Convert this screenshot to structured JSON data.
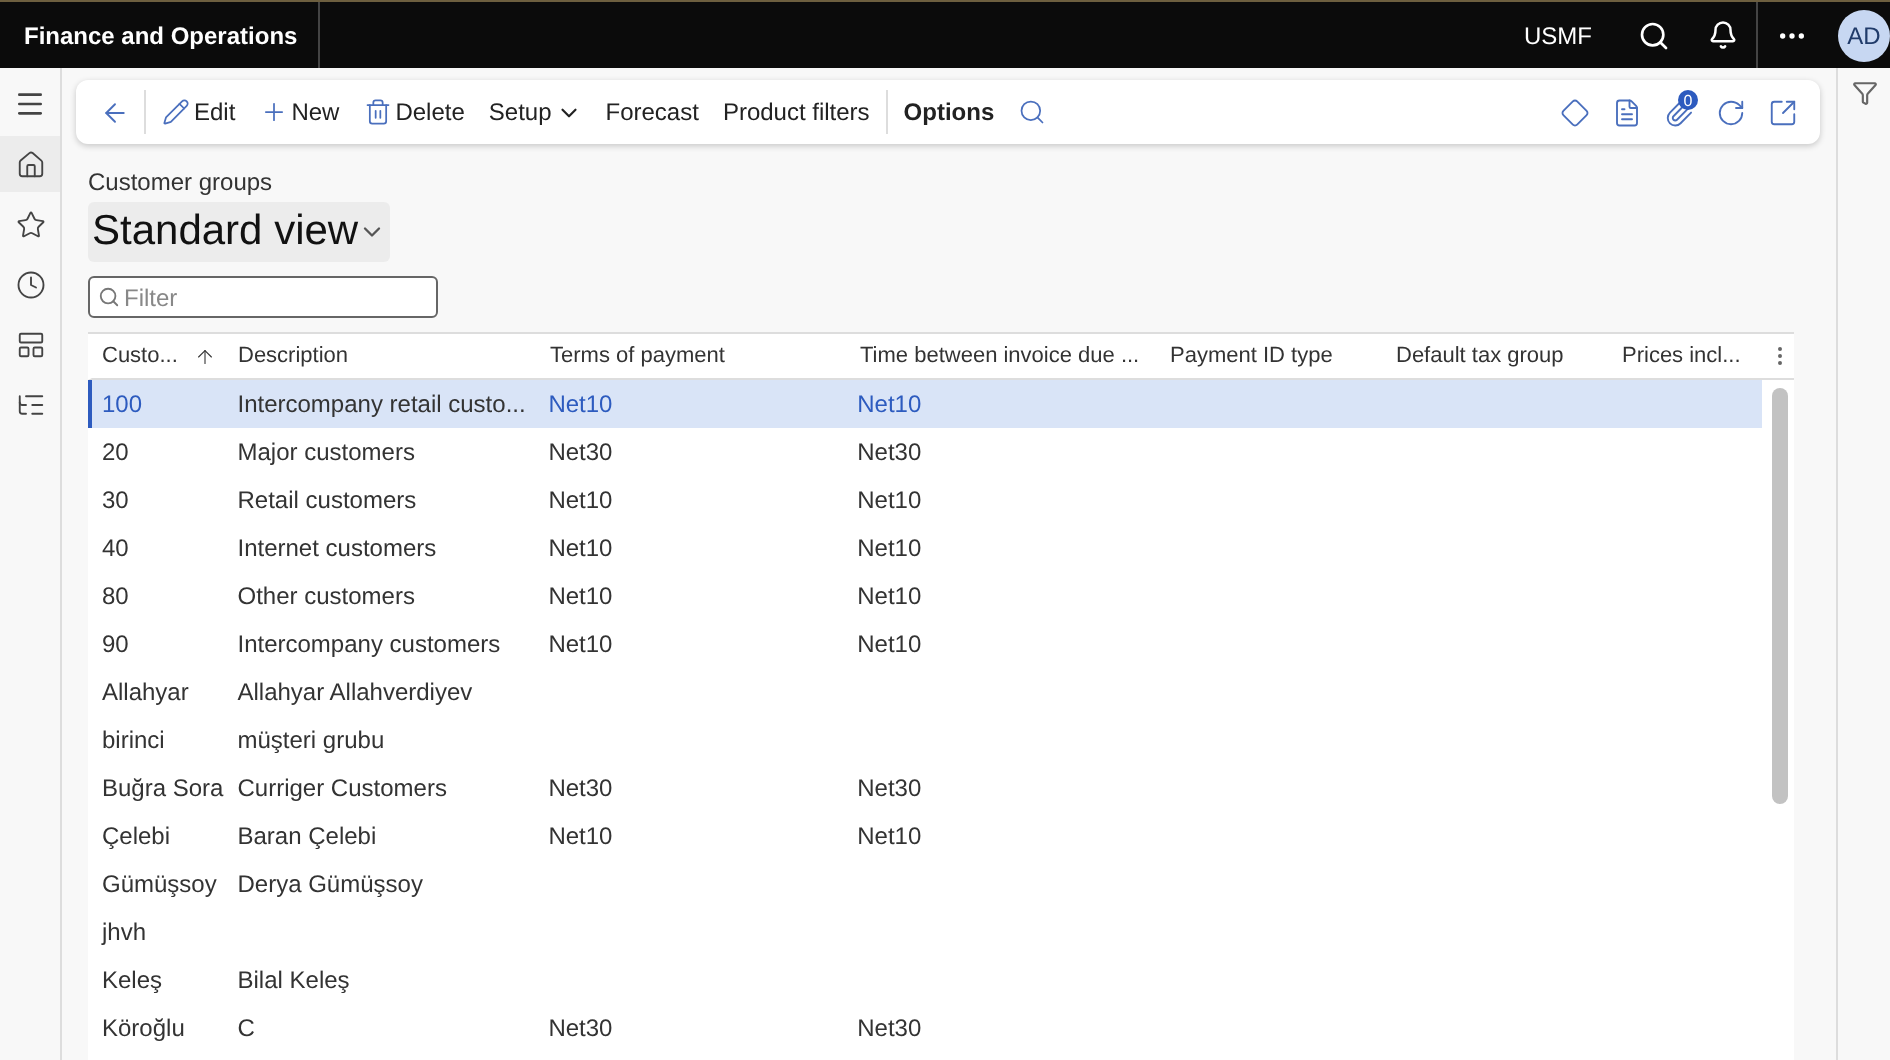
{
  "app_title": "Finance and Operations",
  "top_bar": {
    "company": "USMF",
    "avatar": "AD"
  },
  "nav_rail": [
    {
      "selected": true
    },
    {
      "selected": false
    },
    {
      "selected": false
    },
    {
      "selected": false
    },
    {
      "selected": false
    }
  ],
  "action_pane": {
    "items": [
      {
        "kind": "back"
      },
      {
        "kind": "divider"
      },
      {
        "kind": "button",
        "label": "Edit"
      },
      {
        "kind": "button",
        "label": "New"
      },
      {
        "kind": "button",
        "label": "Delete"
      },
      {
        "kind": "menu",
        "label": "Setup"
      },
      {
        "kind": "button",
        "label": "Forecast"
      },
      {
        "kind": "button",
        "label": "Product filters"
      },
      {
        "kind": "divider"
      },
      {
        "kind": "tab",
        "label": "Options"
      },
      {
        "kind": "search"
      }
    ],
    "attachments_badge": "0"
  },
  "page": {
    "caption": "Customer groups",
    "view": "Standard view",
    "filter": {
      "placeholder": "Filter"
    }
  },
  "table": {
    "columns": [
      {
        "label": "Custo...",
        "sorted": true
      },
      {
        "label": "Description",
        "sorted": false
      },
      {
        "label": "Terms of payment",
        "sorted": false
      },
      {
        "label": "Time between invoice due ...",
        "sorted": false
      },
      {
        "label": "Payment ID type",
        "sorted": false
      },
      {
        "label": "Default tax group",
        "sorted": false
      },
      {
        "label": "Prices incl...",
        "sorted": false
      }
    ],
    "rows": [
      {
        "selected": true,
        "cells": [
          "100",
          "Intercompany retail custo...",
          "Net10",
          "Net10"
        ]
      },
      {
        "selected": false,
        "cells": [
          "20",
          "Major customers",
          "Net30",
          "Net30"
        ]
      },
      {
        "selected": false,
        "cells": [
          "30",
          "Retail customers",
          "Net10",
          "Net10"
        ]
      },
      {
        "selected": false,
        "cells": [
          "40",
          "Internet customers",
          "Net10",
          "Net10"
        ]
      },
      {
        "selected": false,
        "cells": [
          "80",
          "Other customers",
          "Net10",
          "Net10"
        ]
      },
      {
        "selected": false,
        "cells": [
          "90",
          "Intercompany  customers",
          "Net10",
          "Net10"
        ]
      },
      {
        "selected": false,
        "cells": [
          "Allahyar",
          "Allahyar Allahverdiyev",
          "",
          ""
        ]
      },
      {
        "selected": false,
        "cells": [
          "birinci",
          "müşteri grubu",
          "",
          ""
        ]
      },
      {
        "selected": false,
        "cells": [
          "Buğra Sora",
          "Curriger Customers",
          "Net30",
          "Net30"
        ]
      },
      {
        "selected": false,
        "cells": [
          "Çelebi",
          "Baran Çelebi",
          "Net10",
          "Net10"
        ]
      },
      {
        "selected": false,
        "cells": [
          "Gümüşsoy",
          "Derya Gümüşsoy",
          "",
          ""
        ]
      },
      {
        "selected": false,
        "cells": [
          "jhvh",
          "",
          "",
          ""
        ]
      },
      {
        "selected": false,
        "cells": [
          "Keleş",
          "Bilal Keleş",
          "",
          ""
        ]
      },
      {
        "selected": false,
        "cells": [
          "Köroğlu",
          "C",
          "Net30",
          "Net30"
        ]
      }
    ]
  }
}
